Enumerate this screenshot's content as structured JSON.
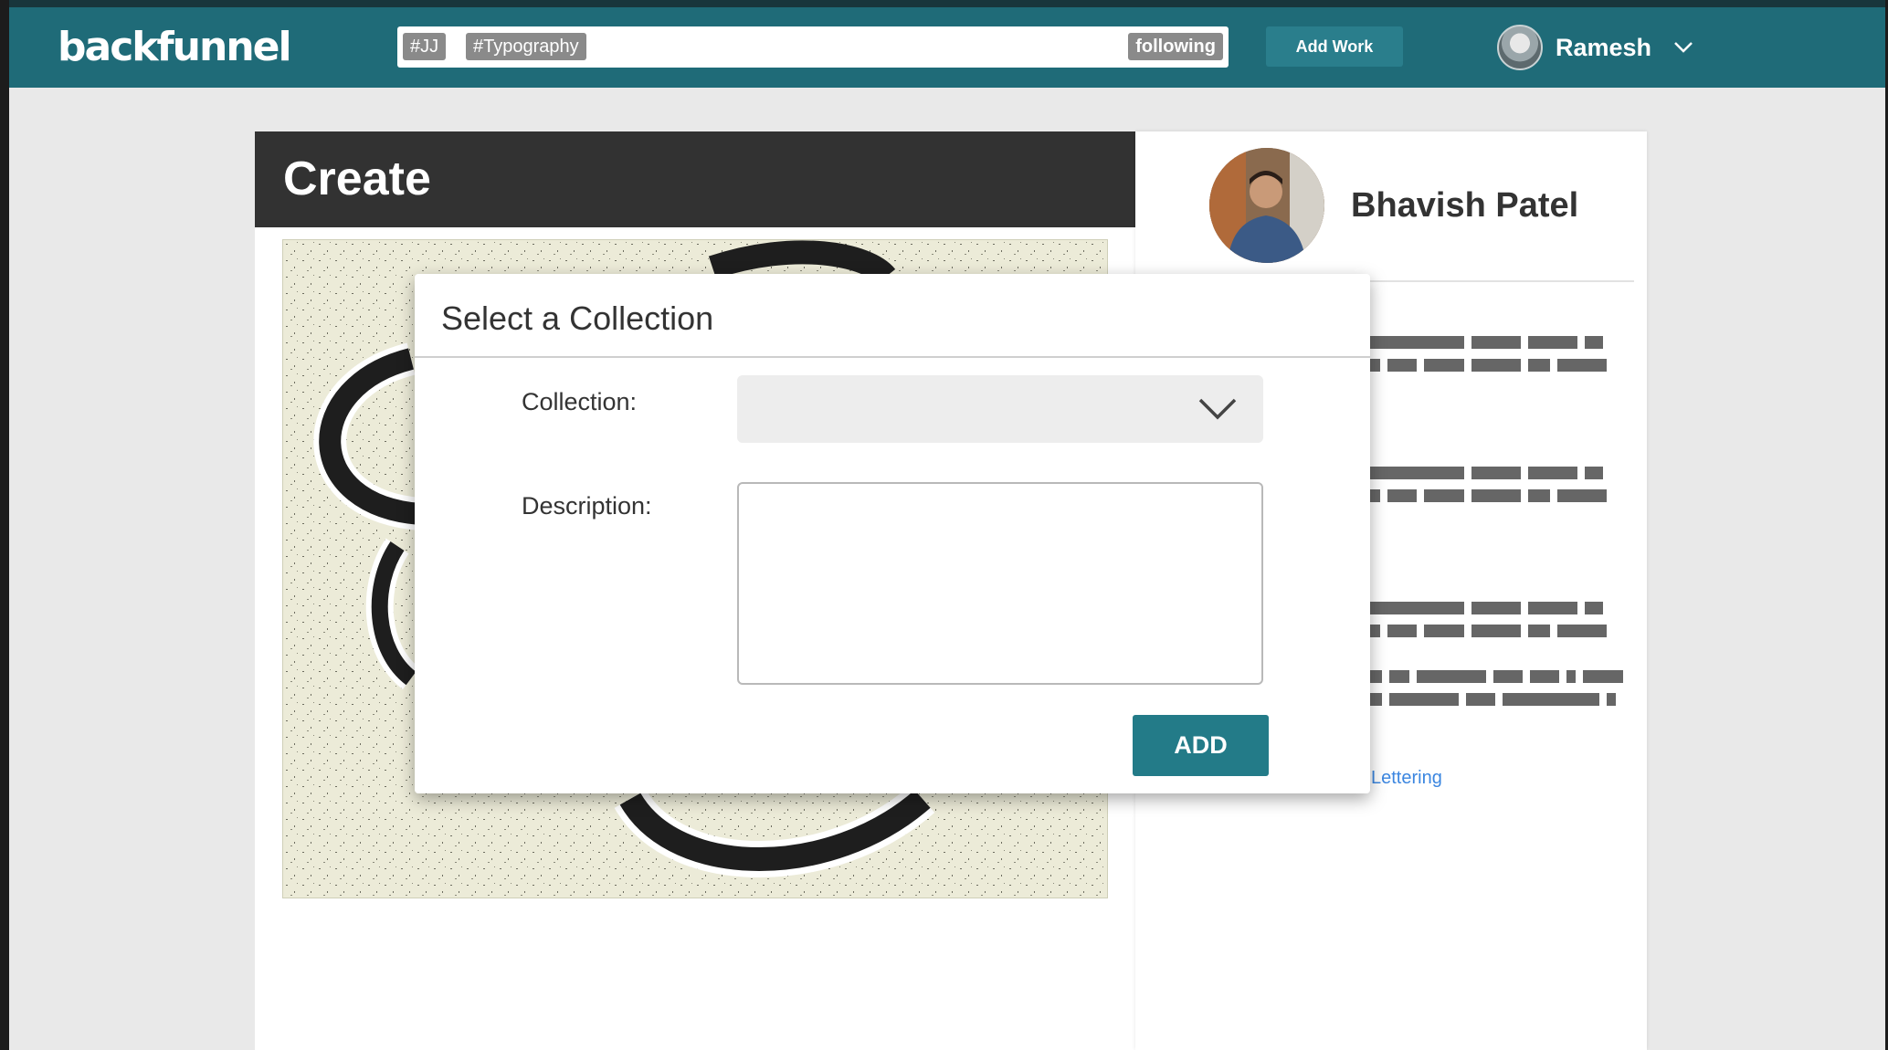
{
  "app": {
    "logo": "backfunnel"
  },
  "header": {
    "tags": [
      "#JJ",
      "#Typography"
    ],
    "filter_badge": "following",
    "add_work_label": "Add Work",
    "user_name": "Ramesh"
  },
  "create_card": {
    "title": "Create"
  },
  "profile": {
    "name": "Bhavish Patel",
    "link_text": "Lettering"
  },
  "modal": {
    "title": "Select a Collection",
    "collection_label": "Collection:",
    "collection_value": "",
    "description_label": "Description:",
    "description_value": "",
    "add_label": "ADD"
  },
  "colors": {
    "topbar": "#1f6b78",
    "accent_button": "#237b88",
    "link": "#3b86e0"
  },
  "icons": {
    "user_menu": "chevron-down-icon",
    "collection_select": "chevron-down-icon"
  }
}
